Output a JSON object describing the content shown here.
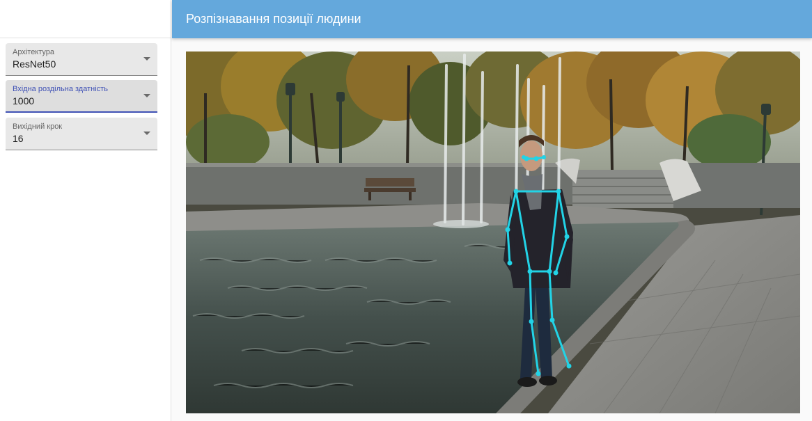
{
  "header": {
    "title": "Розпізнавання позиції людини",
    "accent_color": "#64a8dc"
  },
  "sidebar": {
    "fields": [
      {
        "label": "Архітектура",
        "value": "ResNet50"
      },
      {
        "label": "Вхідна роздільна здатність",
        "value": "1000"
      },
      {
        "label": "Вихідний крок",
        "value": "16"
      }
    ]
  },
  "main": {
    "image": {
      "subject": "person-standing-by-fountain",
      "overlay": "pose-skeleton",
      "skeleton_color": "#22d3e6"
    }
  },
  "icons": {
    "dropdown": "chevron-down-icon"
  }
}
